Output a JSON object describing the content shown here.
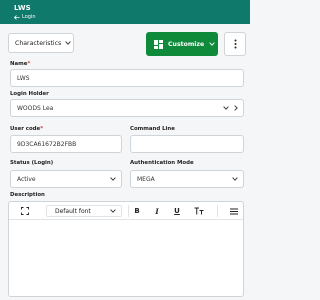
{
  "header": {
    "title": "LWS",
    "breadcrumb": "Login"
  },
  "toolbar": {
    "characteristics_label": "Characteristics",
    "customize_label": "Customize"
  },
  "form": {
    "name": {
      "label": "Name",
      "value": "LWS"
    },
    "login_holder": {
      "label": "Login Holder",
      "value": "WOODS Lea"
    },
    "user_code": {
      "label": "User code",
      "value": "9D3CA61672B2FBB"
    },
    "command_line": {
      "label": "Command Line",
      "value": ""
    },
    "status": {
      "label": "Status (Login)",
      "value": "Active"
    },
    "auth_mode": {
      "label": "Authentication Mode",
      "value": "MEGA"
    },
    "description": {
      "label": "Description",
      "font_label": "Default font"
    }
  },
  "colors": {
    "header": "#0f7a6b",
    "primary_button": "#0f8a3a",
    "required": "#d63a3a"
  }
}
